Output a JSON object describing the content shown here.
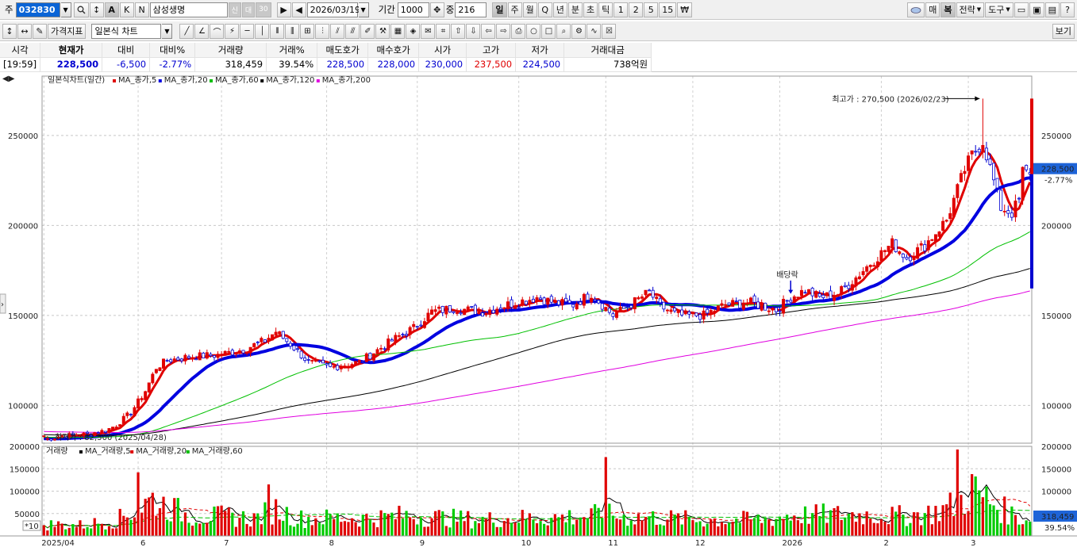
{
  "toolbar1": {
    "market_label": "주",
    "stock_code": "032830",
    "stock_name": "삼성생명",
    "credit_badges": [
      "신",
      "대",
      "30"
    ],
    "date": "2026/03/19",
    "period_label": "기간",
    "period_value": "1000",
    "count_label": "중",
    "count_value": "216",
    "intervals": [
      "일",
      "주",
      "월",
      "Q",
      "년",
      "분",
      "초",
      "틱",
      "1",
      "2",
      "5",
      "15",
      "₩"
    ],
    "selected_interval": "일",
    "right_buttons": [
      "매",
      "복",
      "전략",
      "도구"
    ]
  },
  "toolbar2": {
    "indicator_button": "가격지표",
    "chart_type": "일본식 차트",
    "view_button": "보기"
  },
  "quote": {
    "headers": [
      "시각",
      "현재가",
      "대비",
      "대비%",
      "거래량",
      "거래%",
      "매도호가",
      "매수호가",
      "시가",
      "고가",
      "저가",
      "거래대금"
    ],
    "values": [
      "[19:59]",
      "228,500",
      "-6,500",
      "-2.77%",
      "318,459",
      "39.54%",
      "228,500",
      "228,000",
      "230,000",
      "237,500",
      "224,500",
      "738억원"
    ],
    "colors": {
      "up": "#e00000",
      "down": "#0000d0",
      "neutral": "#000000"
    }
  },
  "chart_data": {
    "type": "candlestick",
    "price_legend": {
      "title": "일본식차트(일간)",
      "items": [
        {
          "label": "MA_종가,5",
          "color": "#e00000"
        },
        {
          "label": "MA_종가,20",
          "color": "#0000e0"
        },
        {
          "label": "MA_종가,60",
          "color": "#00c000"
        },
        {
          "label": "MA_종가,120",
          "color": "#000000"
        },
        {
          "label": "MA_종가,200",
          "color": "#e000e0"
        }
      ]
    },
    "volume_legend": {
      "title": "거래량",
      "items": [
        {
          "label": "MA_거래량,5",
          "color": "#000000"
        },
        {
          "label": "MA_거래량,20",
          "color": "#e00000"
        },
        {
          "label": "MA_거래량,60",
          "color": "#00c000"
        }
      ]
    },
    "price_axis": {
      "min": 79000,
      "max": 283000,
      "ticks": [
        100000,
        150000,
        200000,
        250000
      ]
    },
    "volume_axis": {
      "min": 0,
      "max": 200000,
      "ticks": [
        50000,
        100000,
        150000,
        200000
      ],
      "ticks_labels": [
        "50000",
        "100000",
        "150000",
        "200000"
      ],
      "multiplier_label": "*10"
    },
    "x_labels": [
      "2025/04",
      "6",
      "7",
      "8",
      "9",
      "10",
      "11",
      "12",
      "2026",
      "2",
      "3"
    ],
    "x_label_index": [
      0,
      26,
      49,
      78,
      103,
      131,
      155,
      179,
      203,
      231,
      255
    ],
    "n_days": 273,
    "current_price_label": "228,500",
    "current_change_label": "-2.77%",
    "current_volume_label": "318,459",
    "current_volume_pct_label": "39.54%",
    "annotations": {
      "high": {
        "text": "최고가 : 270,500 (2026/02/23)",
        "value": 270500
      },
      "low": {
        "text": "최저가 : 82,500 (2025/04/28)",
        "value": 82500
      },
      "dividend": {
        "text": "배당락"
      }
    },
    "price_anchors": [
      [
        0,
        81000
      ],
      [
        5,
        83000
      ],
      [
        12,
        84000
      ],
      [
        17,
        86000
      ],
      [
        20,
        89000
      ],
      [
        24,
        96000
      ],
      [
        28,
        108000
      ],
      [
        31,
        121000
      ],
      [
        34,
        125000
      ],
      [
        40,
        127000
      ],
      [
        48,
        128000
      ],
      [
        55,
        131000
      ],
      [
        61,
        136000
      ],
      [
        64,
        141000
      ],
      [
        68,
        134000
      ],
      [
        73,
        124000
      ],
      [
        79,
        121000
      ],
      [
        87,
        124000
      ],
      [
        96,
        136000
      ],
      [
        102,
        143000
      ],
      [
        107,
        152000
      ],
      [
        113,
        154000
      ],
      [
        121,
        152000
      ],
      [
        128,
        156000
      ],
      [
        136,
        160000
      ],
      [
        141,
        157000
      ],
      [
        146,
        156000
      ],
      [
        151,
        162000
      ],
      [
        157,
        150000
      ],
      [
        161,
        155000
      ],
      [
        167,
        163000
      ],
      [
        170,
        155000
      ],
      [
        175,
        150000
      ],
      [
        182,
        150000
      ],
      [
        188,
        156000
      ],
      [
        195,
        157000
      ],
      [
        202,
        153000
      ],
      [
        206,
        160000
      ],
      [
        210,
        164000
      ],
      [
        214,
        160000
      ],
      [
        219,
        162000
      ],
      [
        224,
        171000
      ],
      [
        228,
        179000
      ],
      [
        234,
        190000
      ],
      [
        238,
        182000
      ],
      [
        243,
        189000
      ],
      [
        249,
        203000
      ],
      [
        254,
        231000
      ],
      [
        256,
        239000
      ],
      [
        259,
        247000
      ],
      [
        261,
        232000
      ],
      [
        264,
        210000
      ],
      [
        267,
        207000
      ],
      [
        269,
        214000
      ],
      [
        270,
        230000
      ],
      [
        272,
        228500
      ]
    ],
    "volume_anchors": [
      [
        0,
        26000
      ],
      [
        10,
        24000
      ],
      [
        20,
        35000
      ],
      [
        26,
        62000
      ],
      [
        30,
        82000
      ],
      [
        34,
        67000
      ],
      [
        40,
        45000
      ],
      [
        50,
        44000
      ],
      [
        58,
        39000
      ],
      [
        64,
        60000
      ],
      [
        70,
        39000
      ],
      [
        80,
        40000
      ],
      [
        90,
        40000
      ],
      [
        100,
        46000
      ],
      [
        110,
        41000
      ],
      [
        120,
        36000
      ],
      [
        130,
        40000
      ],
      [
        140,
        41000
      ],
      [
        150,
        45000
      ],
      [
        155,
        48000
      ],
      [
        160,
        42000
      ],
      [
        170,
        41000
      ],
      [
        180,
        36000
      ],
      [
        190,
        36000
      ],
      [
        200,
        37000
      ],
      [
        205,
        46000
      ],
      [
        215,
        47000
      ],
      [
        225,
        48000
      ],
      [
        235,
        44000
      ],
      [
        245,
        51000
      ],
      [
        252,
        72000
      ],
      [
        256,
        101000
      ],
      [
        260,
        83000
      ],
      [
        264,
        61000
      ],
      [
        268,
        45000
      ],
      [
        272,
        31846
      ]
    ],
    "volume_spikes": [
      [
        26,
        142000
      ],
      [
        62,
        115000
      ],
      [
        155,
        176000
      ],
      [
        252,
        193000
      ],
      [
        256,
        138000
      ]
    ],
    "ma_lines": [
      {
        "name": "MA_종가,5",
        "color": "#e00000",
        "width": 3
      },
      {
        "name": "MA_종가,20",
        "color": "#0000e0",
        "width": 4
      },
      {
        "name": "MA_종가,60",
        "color": "#00c000",
        "width": 1
      },
      {
        "name": "MA_종가,120",
        "color": "#000000",
        "width": 1
      },
      {
        "name": "MA_종가,200",
        "color": "#e000e0",
        "width": 1
      }
    ]
  }
}
